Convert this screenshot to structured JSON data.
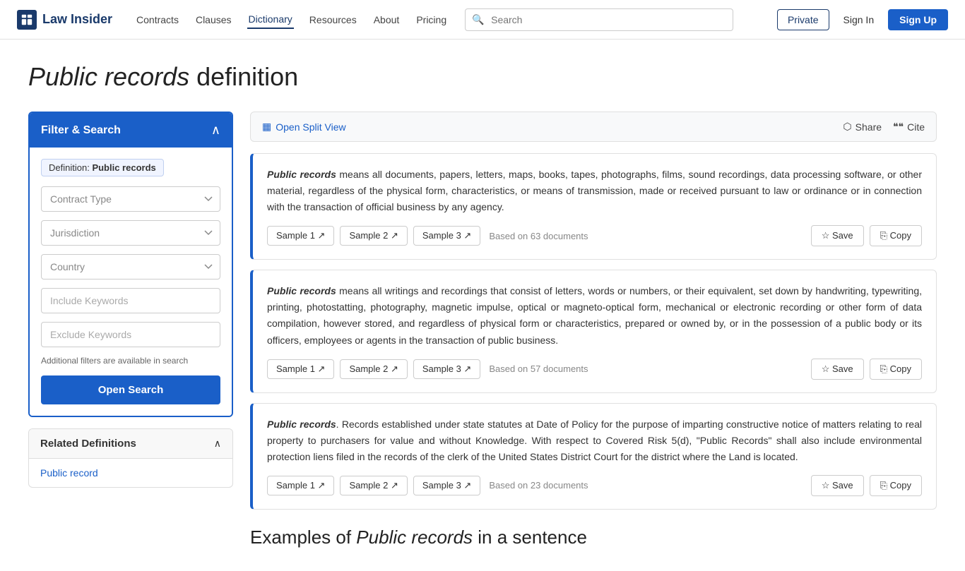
{
  "navbar": {
    "brand": "Law Insider",
    "links": [
      "Contracts",
      "Clauses",
      "Dictionary",
      "Resources",
      "About",
      "Pricing"
    ],
    "active_link": "Dictionary",
    "search_placeholder": "Search",
    "btn_private": "Private",
    "btn_signin": "Sign In",
    "btn_signup": "Sign Up"
  },
  "page": {
    "title_italic": "Public records",
    "title_normal": " definition"
  },
  "sidebar": {
    "filter_title": "Filter & Search",
    "filter_tag_prefix": "Definition:",
    "filter_tag_value": "Public records",
    "contract_type_placeholder": "Contract Type",
    "jurisdiction_placeholder": "Jurisdiction",
    "country_placeholder": "Country",
    "include_keywords_placeholder": "Include Keywords",
    "exclude_keywords_placeholder": "Exclude Keywords",
    "filter_note": "Additional filters are available in search",
    "open_search_label": "Open Search",
    "related_title": "Related Definitions",
    "related_link": "Public record"
  },
  "toolbar": {
    "split_view_label": "Open Split View",
    "share_label": "Share",
    "cite_label": "Cite"
  },
  "results": [
    {
      "id": 1,
      "text_bold": "Public records",
      "text_rest": " means all documents, papers, letters, maps, books, tapes, photographs, films, sound recordings, data processing software, or other material, regardless of the physical form, characteristics, or means of transmission, made or received pursuant to law or ordinance or in connection with the transaction of official business by any agency.",
      "samples": [
        "Sample 1",
        "Sample 2",
        "Sample 3"
      ],
      "based_on": "Based on 63 documents",
      "save_label": "Save",
      "copy_label": "Copy"
    },
    {
      "id": 2,
      "text_bold": "Public records",
      "text_rest": " means all writings and recordings that consist of letters, words or numbers, or their equivalent, set down by handwriting, typewriting, printing, photostatting, photography, magnetic impulse, optical or magneto-optical form, mechanical or electronic recording or other form of data compilation, however stored, and regardless of physical form or characteristics, prepared or owned by, or in the possession of a public body or its officers, employees or agents in the transaction of public business.",
      "samples": [
        "Sample 1",
        "Sample 2",
        "Sample 3"
      ],
      "based_on": "Based on 57 documents",
      "save_label": "Save",
      "copy_label": "Copy"
    },
    {
      "id": 3,
      "text_bold": "Public records",
      "text_rest": ". Records established under state statutes at Date of Policy for the purpose of imparting constructive notice of matters relating to real property to purchasers for value and without Knowledge. With respect to Covered Risk 5(d), \"Public Records\" shall also include environmental protection liens filed in the records of the clerk of the United States District Court for the district where the Land is located.",
      "samples": [
        "Sample 1",
        "Sample 2",
        "Sample 3"
      ],
      "based_on": "Based on 23 documents",
      "save_label": "Save",
      "copy_label": "Copy"
    }
  ],
  "examples_section": {
    "title_italic": "Public records",
    "title_normal": " in a sentence"
  },
  "icons": {
    "brand": "⊞",
    "search": "🔍",
    "split_view": "▦",
    "share": "⬡",
    "cite": "❝",
    "chevron_up": "∧",
    "chevron_down": "∨",
    "external_link": "↗",
    "star": "☆",
    "copy": "⎘"
  }
}
